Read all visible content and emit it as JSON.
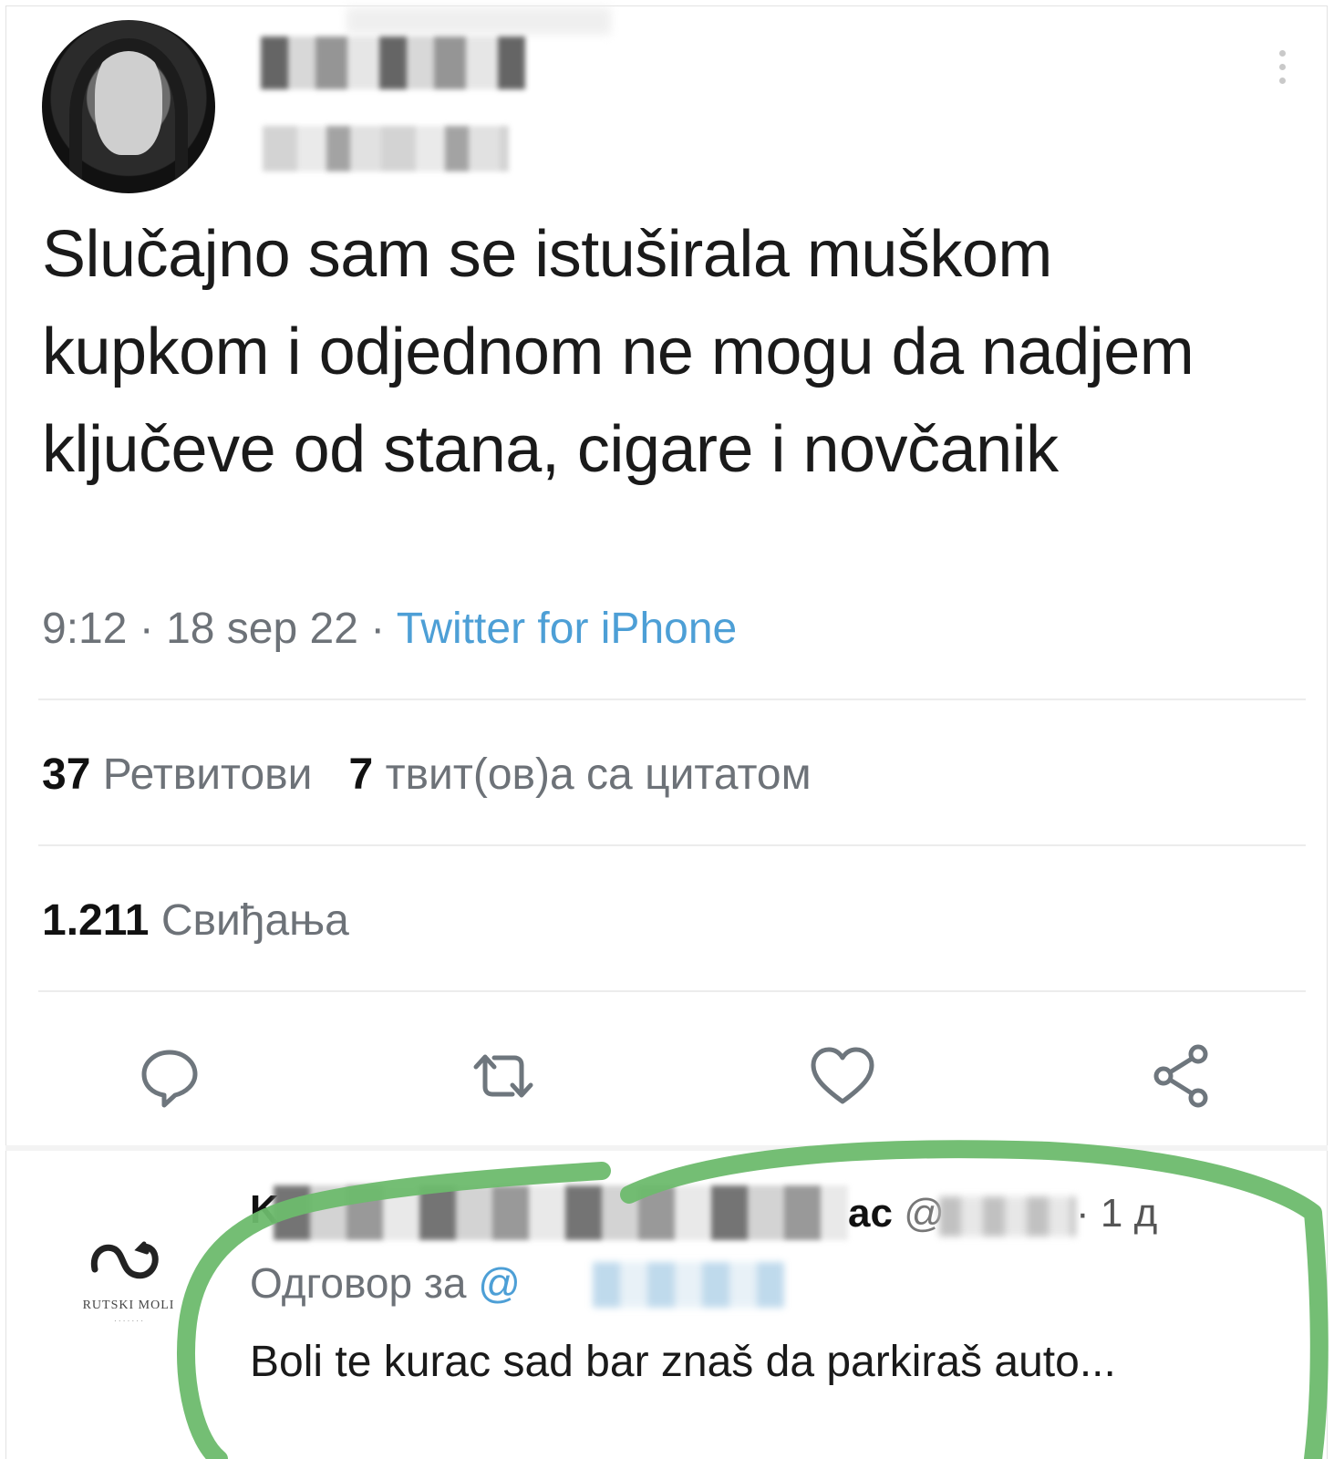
{
  "tweet": {
    "text": "Slučajno sam se istuširala muškom kupkom i odjednom ne mogu da nadjem ključeve od stana, cigare i novčanik",
    "time": "9:12",
    "date": "18 sep 22",
    "source": "Twitter for iPhone",
    "separator": " · "
  },
  "stats": {
    "retweets_count": "37",
    "retweets_label": "Ретвитови",
    "quotes_count": "7",
    "quotes_label": "твит(ов)а са цитатом",
    "likes_count": "1.211",
    "likes_label": "Свиђања"
  },
  "actions": {
    "icons": [
      "reply-icon",
      "retweet-icon",
      "like-icon",
      "share-icon"
    ]
  },
  "reply": {
    "name_start": "K",
    "name_end": "ac",
    "handle_prefix": "@",
    "time": "· 1 д",
    "reply_to_label": "Одговор за",
    "reply_to_at": "@",
    "text": "Boli te kurac sad bar znaš da parkiraš auto...",
    "logo_text": "RUTSKI MOLI",
    "highlight_color": "#6dbb6d"
  }
}
